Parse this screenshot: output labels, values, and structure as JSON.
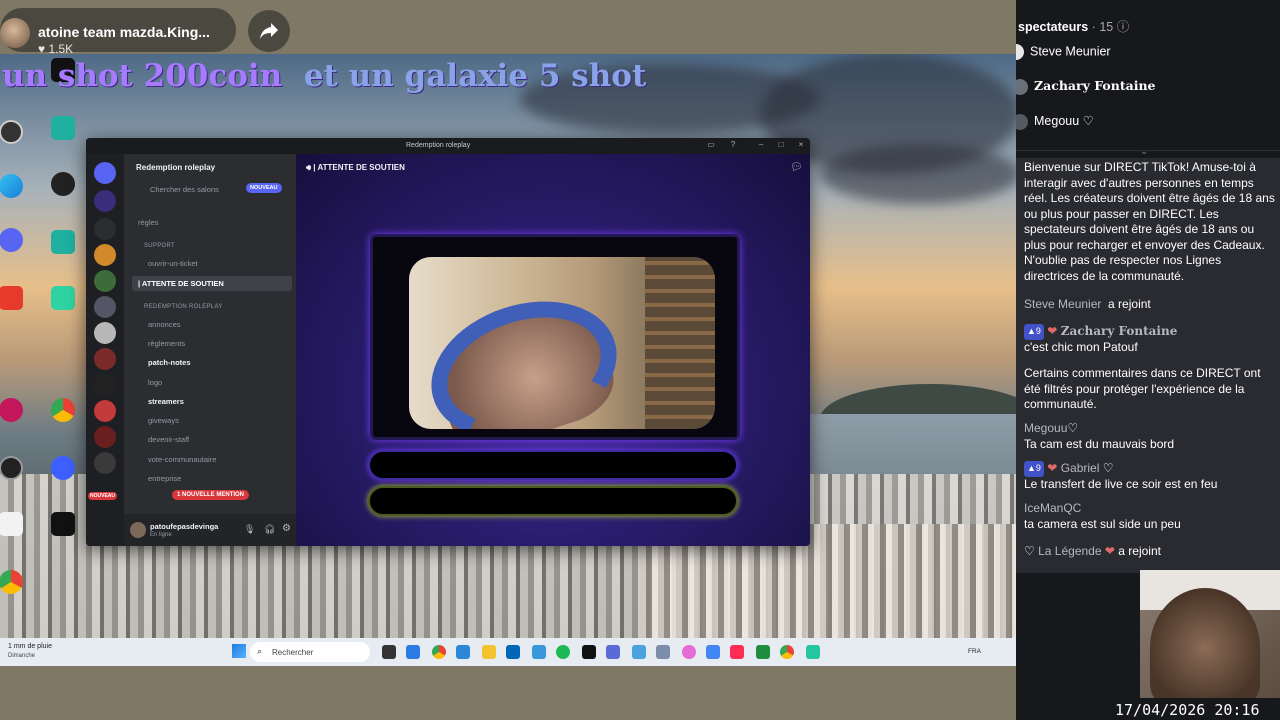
{
  "stream": {
    "streamer_name": "atoine team mazda.King...",
    "likes": "1.5K",
    "overlay_text_a": "un shot 200coin",
    "overlay_text_b": "et un galaxie 5 shot"
  },
  "discord": {
    "window_title": "Redemption roleplay",
    "server_name": "Redemption roleplay",
    "search_placeholder": "Chercher des salons",
    "new_badge": "NOUVEAU",
    "channel_header": "| ATTENTE DE SOUTIEN",
    "categories": [
      "SUPPORT",
      "REDEMPTION ROLEPLAY"
    ],
    "channels": [
      {
        "label": "règles",
        "style": "dim"
      },
      {
        "label": "ouvrir-un-ticket",
        "style": "dim"
      },
      {
        "label": "| ATTENTE DE SOUTIEN",
        "style": "selected"
      },
      {
        "label": "annonces",
        "style": "dim"
      },
      {
        "label": "règlements",
        "style": "dim"
      },
      {
        "label": "patch-notes",
        "style": "bright"
      },
      {
        "label": "logo",
        "style": "dim"
      },
      {
        "label": "streamers",
        "style": "bright"
      },
      {
        "label": "giveways",
        "style": "dim"
      },
      {
        "label": "devenir-staff",
        "style": "dim"
      },
      {
        "label": "vote-communautaire",
        "style": "dim"
      },
      {
        "label": "entreprise",
        "style": "dim"
      }
    ],
    "mention_badge": "1 NOUVELLE MENTION",
    "guild_new_badge": "NOUVEAU",
    "user_name": "patoufepasdevinga",
    "user_status": "En ligne"
  },
  "taskbar": {
    "weather_temp": "1 mm de pluie",
    "weather_day": "Dimanche",
    "search_placeholder": "Rechercher",
    "language": "FRA"
  },
  "chat": {
    "viewers_label": "spectateurs",
    "viewers_count": "15",
    "top_viewers": [
      "Steve Meunier",
      "Zachary Fontaine",
      "Megouu"
    ],
    "welcome_text": "Bienvenue sur DIRECT TikTok! Amuse-toi à interagir avec d'autres personnes en temps réel. Les créateurs doivent être âgés de 18 ans ou plus pour passer en DIRECT. Les spectateurs doivent être âgés de 18 ans ou plus pour recharger et envoyer des Cadeaux. N'oublie pas de respecter nos Lignes directrices de la communauté.",
    "joined_1_user": "Steve Meunier",
    "joined_label": "a rejoint",
    "msg_1_level": "9",
    "msg_1_user": "Zachary Fontaine",
    "msg_1_text": "c'est chic mon Patouf",
    "filtered_text": "Certains commentaires dans ce DIRECT ont été filtrés pour protéger l'expérience de la communauté.",
    "msg_2_user": "Megouu",
    "msg_2_text": "Ta cam est du mauvais bord",
    "msg_3_level": "9",
    "msg_3_user": "Gabriel",
    "msg_3_text": "Le transfert de live ce soir est en feu",
    "msg_4_user": "IceManQC",
    "msg_4_text": "ta camera est sul side un peu",
    "joined_2_user": "La Légende"
  },
  "datetime": "17/04/2026 20:16",
  "colors": {
    "overlay_purple": "#a77bff",
    "overlay_blue": "#8aa2e8",
    "discord_blurple": "#5865f2",
    "mention_red": "#da373c",
    "chat_bg": "#2a2b30"
  }
}
